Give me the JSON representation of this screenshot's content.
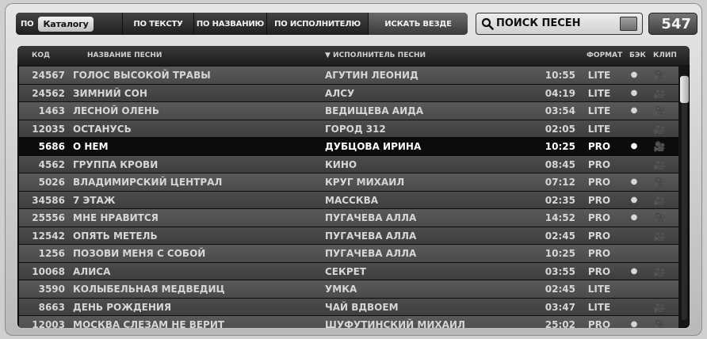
{
  "toolbar": {
    "tabs": {
      "prefix": "ПО",
      "catalog": "Каталогу",
      "by_text": "ПО ТЕКСТУ",
      "by_title": "ПО НАЗВАНИЮ",
      "by_artist": "ПО ИСПОЛНИТЕЛЮ",
      "search_all": "ИСКАТЬ ВЕЗДЕ"
    },
    "search_text": "ПОИСК ПЕСЕН",
    "counter": "547"
  },
  "table": {
    "columns": {
      "code": "КОД",
      "title": "НАЗВАНИЕ ПЕСНИ",
      "artist": "▼ ИСПОЛНИТЕЛЬ ПЕСНИ",
      "format": "ФОРМАТ",
      "backing": "БЭК",
      "clip": "КЛИП"
    },
    "rows": [
      {
        "code": "24567",
        "title": "ГОЛОС ВЫСОКОЙ ТРАВЫ",
        "artist": "АГУТИН ЛЕОНИД",
        "time": "10:55",
        "format": "LITE",
        "backing": "●",
        "clip": "🎥"
      },
      {
        "code": "24562",
        "title": "ЗИМНИЙ СОН",
        "artist": "АЛСУ",
        "time": "04:19",
        "format": "LITE",
        "backing": "●",
        "clip": "🎥"
      },
      {
        "code": "1463",
        "title": "ЛЕСНОЙ ОЛЕНЬ",
        "artist": "ВЕДИЩЕВА АИДА",
        "time": "03:54",
        "format": "LITE",
        "backing": "●",
        "clip": "🎥"
      },
      {
        "code": "12035",
        "title": "ОСТАНУСЬ",
        "artist": "ГОРОД 312",
        "time": "02:05",
        "format": "LITE",
        "backing": "",
        "clip": "🎥"
      },
      {
        "code": "5686",
        "title": "О НЕМ",
        "artist": "ДУБЦОВА ИРИНА",
        "time": "10:25",
        "format": "PRO",
        "backing": "●",
        "clip": "🎥"
      },
      {
        "code": "4562",
        "title": "ГРУППА КРОВИ",
        "artist": "КИНО",
        "time": "08:45",
        "format": "PRO",
        "backing": "",
        "clip": "🎥"
      },
      {
        "code": "5026",
        "title": "ВЛАДИМИРСКИЙ ЦЕНТРАЛ",
        "artist": "КРУГ МИХАИЛ",
        "time": "07:12",
        "format": "PRO",
        "backing": "●",
        "clip": "🎥"
      },
      {
        "code": "34586",
        "title": "7 ЭТАЖ",
        "artist": "МАССКВА",
        "time": "02:35",
        "format": "PRO",
        "backing": "●",
        "clip": "🎥"
      },
      {
        "code": "25556",
        "title": "МНЕ НРАВИТСЯ",
        "artist": "ПУГАЧЕВА АЛЛА",
        "time": "14:52",
        "format": "PRO",
        "backing": "●",
        "clip": "🎥"
      },
      {
        "code": "12542",
        "title": "ОПЯТЬ МЕТЕЛЬ",
        "artist": "ПУГАЧЕВА АЛЛА",
        "time": "02:45",
        "format": "PRO",
        "backing": "",
        "clip": "🎥"
      },
      {
        "code": "1256",
        "title": "ПОЗОВИ МЕНЯ С СОБОЙ",
        "artist": "ПУГАЧЕВА АЛЛА",
        "time": "10:25",
        "format": "PRO",
        "backing": "",
        "clip": ""
      },
      {
        "code": "10068",
        "title": "АЛИСА",
        "artist": "СЕКРЕТ",
        "time": "03:55",
        "format": "PRO",
        "backing": "●",
        "clip": "🎥"
      },
      {
        "code": "3590",
        "title": "КОЛЫБЕЛЬНАЯ МЕДВЕДИЦ",
        "artist": "УМКА",
        "time": "02:45",
        "format": "LITE",
        "backing": "",
        "clip": ""
      },
      {
        "code": "8663",
        "title": "ДЕНЬ РОЖДЕНИЯ",
        "artist": "ЧАЙ ВДВОЕМ",
        "time": "03:47",
        "format": "LITE",
        "backing": "",
        "clip": "🎥"
      },
      {
        "code": "12003",
        "title": "МОСКВА СЛЕЗАМ НЕ ВЕРИТ",
        "artist": "ШУФУТИНСКИЙ МИХАИЛ",
        "time": "25:02",
        "format": "PRO",
        "backing": "●",
        "clip": "🎥"
      }
    ],
    "selected_row": 4
  }
}
